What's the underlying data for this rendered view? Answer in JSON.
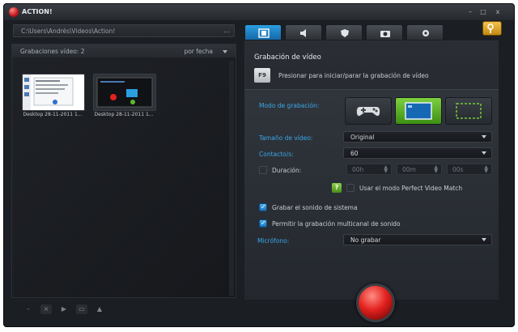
{
  "window": {
    "title": "ACTION!",
    "controls": [
      "–",
      "□",
      "x"
    ]
  },
  "path_bar": {
    "value": "C:\\Users\\Andrés\\Videos\\Action!",
    "browse": "..."
  },
  "library": {
    "count_label": "Grabaciones vídeo: 2",
    "sort_label": "por fecha",
    "items": [
      {
        "caption": "Desktop 28-11-2011 1..."
      },
      {
        "caption": "Desktop 28-11-2011 1..."
      }
    ]
  },
  "toolbar": {
    "minus": "–",
    "delete": "×",
    "play": "▶",
    "folder": "▭",
    "upload": "▲"
  },
  "tabs": [
    {
      "name": "video",
      "icon": "film-icon",
      "active": true
    },
    {
      "name": "audio",
      "icon": "speaker-icon",
      "active": false
    },
    {
      "name": "benchmark",
      "icon": "shield-icon",
      "active": false
    },
    {
      "name": "screenshot",
      "icon": "camera-icon",
      "active": false
    },
    {
      "name": "settings",
      "icon": "gear-icon",
      "active": false
    }
  ],
  "video": {
    "section_title": "Grabación de vídeo",
    "hotkey": "F9",
    "hotkey_desc": "Presionar para iniciar/parar la grabación de vídeo",
    "mode_label": "Modo de grabación:",
    "modes": [
      "gamepad-icon",
      "desktop-icon",
      "region-icon"
    ],
    "active_mode": 1,
    "size_label": "Tamaño de vídeo:",
    "size_value": "Original",
    "fps_label": "Contacto/s:",
    "fps_value": "60",
    "duration_label": "Duración:",
    "duration": {
      "h": "00h",
      "m": "00m",
      "s": "00s"
    },
    "duration_checked": false,
    "perfect_match_label": "Usar el modo Perfect Video Match",
    "perfect_match_checked": false,
    "help": "?",
    "system_sound_label": "Grabar el sonido de sistema",
    "system_sound_checked": true,
    "multichannel_label": "Permitir la grabación multicanal de sonido",
    "multichannel_checked": true,
    "mic_label": "Micrófono:",
    "mic_value": "No grabar"
  },
  "colors": {
    "accent_blue": "#2b9ee0",
    "active_green": "#5cb82a",
    "record_red": "#e3221f",
    "key_yellow": "#e0a62a"
  }
}
